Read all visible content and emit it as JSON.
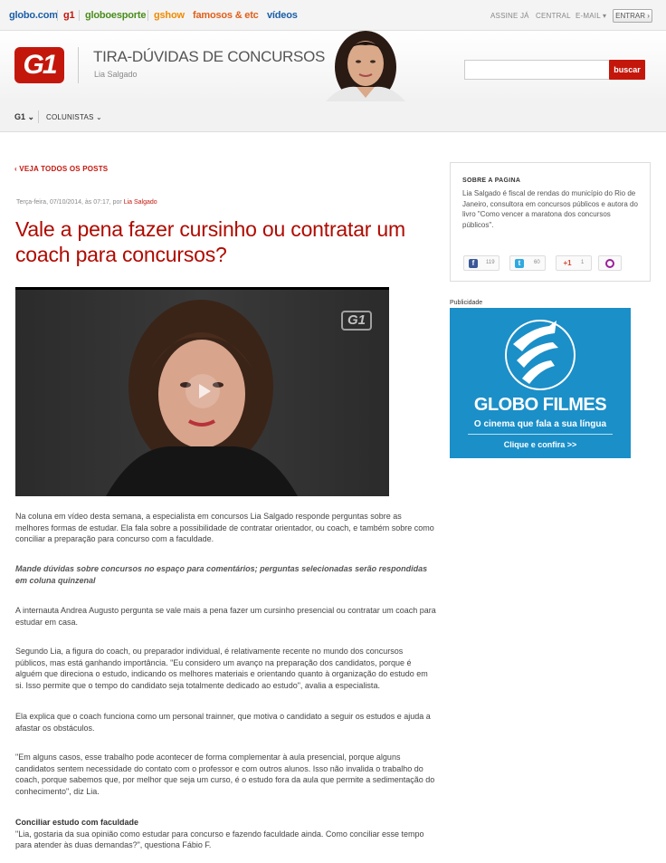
{
  "topbar": {
    "sites": [
      {
        "label": "globo.com",
        "color": "#1a5fa8"
      },
      {
        "label": "g1",
        "color": "#c4170c"
      },
      {
        "label": "globoesporte",
        "color": "#4a8d1c"
      },
      {
        "label": "gshow",
        "color": "#f08a00"
      },
      {
        "label": "famosos & etc",
        "color": "#e0601b"
      },
      {
        "label": "vídeos",
        "color": "#1a5fa8"
      }
    ],
    "utility": [
      "ASSINE JÁ",
      "CENTRAL",
      "E-MAIL"
    ],
    "email_caret": "▾",
    "login_label": "ENTRAR ›"
  },
  "header": {
    "logo": "G1",
    "blog_title": "TIRA-DÚVIDAS DE CONCURSOS",
    "author": "Lia Salgado",
    "search_placeholder": "",
    "search_button": "buscar"
  },
  "nav": {
    "g1": "G1 ⌄",
    "colunistas": "COLUNISTAS ⌄"
  },
  "article": {
    "back_link": "‹ VEJA TODOS OS POSTS",
    "date": "Terça-feira, 07/10/2014, às 07:17, por",
    "byline": "Lia Salgado",
    "headline": "Vale a pena fazer cursinho ou contratar um coach para concursos?",
    "video_logo": "G1",
    "p1": "Na coluna em vídeo desta semana, a especialista em concursos Lia Salgado responde perguntas sobre as melhores formas de estudar. Ela fala sobre a possibilidade de contratar orientador, ou coach, e também sobre como conciliar a preparação para concurso com a faculdade.",
    "p2": "Mande dúvidas sobre concursos no espaço para comentários; perguntas selecionadas serão respondidas em coluna quinzenal",
    "p3": "A internauta Andrea Augusto pergunta se vale mais a pena fazer um cursinho presencial ou contratar um coach para estudar em casa.",
    "p4": "Segundo Lia, a figura do coach, ou preparador individual, é relativamente recente no mundo dos concursos públicos, mas está ganhando importância. \"Eu considero um avanço na preparação dos candidatos, porque é alguém que direciona o estudo, indicando os melhores materiais e orientando quanto à organização do estudo em si. Isso permite que o tempo do candidato seja totalmente dedicado ao estudo\", avalia a especialista.",
    "p5": "Ela explica que o coach funciona como um personal trainner, que motiva o candidato a seguir os estudos e ajuda a afastar os obstáculos.",
    "p6": "\"Em alguns casos, esse trabalho pode acontecer de forma complementar à aula presencial, porque alguns candidatos sentem necessidade do contato com o professor e com outros alunos. Isso não invalida o trabalho do coach, porque sabemos que, por melhor que seja um curso, é o estudo fora da aula que permite a sedimentação do conhecimento\", diz Lia.",
    "p7_heading": "Conciliar estudo com faculdade",
    "p7": "\"Lia, gostaria da sua opinião como estudar para concurso e fazendo faculdade ainda. Como conciliar esse tempo para atender às duas demandas?\", questiona Fábio F."
  },
  "sidebar": {
    "about_title": "SOBRE A PAGINA",
    "about_text": "Lia Salgado é fiscal de rendas do município do Rio de Janeiro, consultora em concursos públicos e autora do livro \"Como vencer a maratona dos concursos públicos\".",
    "share": [
      {
        "icon": "f",
        "count": "119",
        "color": "#3b5998"
      },
      {
        "icon": "t",
        "count": "60",
        "color": "#2fa9e0"
      },
      {
        "icon": "+1",
        "count": "1",
        "color": "#d34836"
      },
      {
        "icon": "o",
        "count": "",
        "color": "#9b1f9b"
      }
    ],
    "ad_label": "Publicidade",
    "ad_title": "GLOBO FILMES",
    "ad_tagline": "O cinema que fala a sua língua",
    "ad_cta": "Clique e confira >>"
  }
}
